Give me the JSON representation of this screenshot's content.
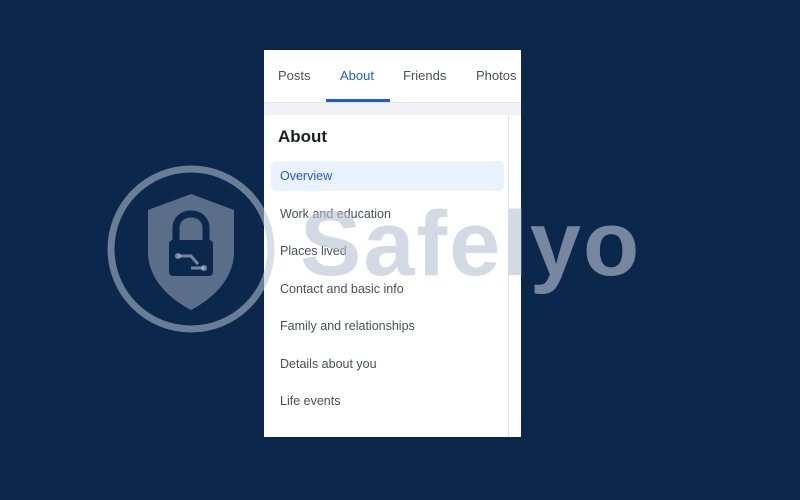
{
  "tabs": [
    {
      "label": "Posts",
      "active": false
    },
    {
      "label": "About",
      "active": true
    },
    {
      "label": "Friends",
      "active": false
    },
    {
      "label": "Photos",
      "active": false
    }
  ],
  "about": {
    "title": "About",
    "items": [
      {
        "label": "Overview",
        "active": true
      },
      {
        "label": "Work and education",
        "active": false
      },
      {
        "label": "Places lived",
        "active": false
      },
      {
        "label": "Contact and basic info",
        "active": false
      },
      {
        "label": "Family and relationships",
        "active": false
      },
      {
        "label": "Details about you",
        "active": false
      },
      {
        "label": "Life events",
        "active": false
      }
    ]
  },
  "watermark": {
    "text": "Safelyo",
    "icon": "shield-lock-icon"
  },
  "colors": {
    "background": "#0b274c",
    "accent": "#1b5ed1",
    "active_item_bg": "#eaf2fd",
    "watermark": "#bac4d4"
  }
}
